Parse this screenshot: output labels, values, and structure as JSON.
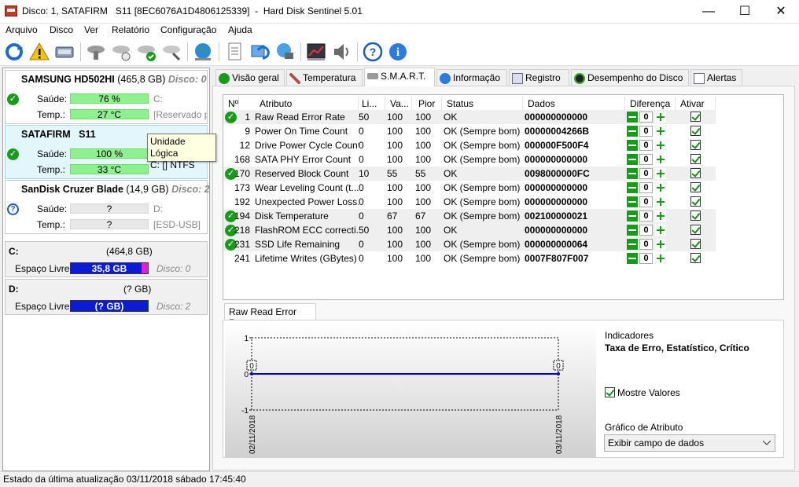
{
  "window": {
    "title": "Disco: 1, SATAFIRM   S11 [8EC6076A1D4806125339]  -  Hard Disk Sentinel 5.01",
    "minimize": "—",
    "maximize": "☐",
    "close": "✕"
  },
  "menu": [
    {
      "label": "Arquivo"
    },
    {
      "label": "Disco"
    },
    {
      "label": "Ver"
    },
    {
      "label": "Relatório"
    },
    {
      "label": "Configuração"
    },
    {
      "label": "Ajuda"
    }
  ],
  "disks": [
    {
      "name": "SAMSUNG HD502HI",
      "size": "(465,8 GB)",
      "disk": "Disco: 0",
      "health_label": "Saúde:",
      "health": "76 %",
      "temp_label": "Temp.:",
      "temp": "27 °C",
      "drive": "C:",
      "drive_note": "[Reservado p"
    },
    {
      "name": "SATAFIRM   S11",
      "size": "",
      "disk": "",
      "health_label": "Saúde:",
      "health": "100 %",
      "temp_label": "Temp.:",
      "temp": "33 °C",
      "drive": "",
      "drive_note": ""
    },
    {
      "name": "SanDisk Cruzer Blade",
      "size": "(14,9 GB)",
      "disk": "Disco: 2",
      "health_label": "Saúde:",
      "health": "?",
      "temp_label": "Temp.:",
      "temp": "?",
      "drive": "D:",
      "drive_note": "[ESD-USB]"
    }
  ],
  "tooltip": {
    "line1": "Unidade Lógica",
    "line2": "C: [] NTFS"
  },
  "volumes": [
    {
      "letter": "C:",
      "size": "(464,8 GB)",
      "free_label": "Espaço Livre",
      "free": "35,8 GB",
      "disk": "Disco: 0",
      "free_fraction": 0.077
    },
    {
      "letter": "D:",
      "size": "(? GB)",
      "free_label": "Espaço Livre",
      "free": "(? GB)",
      "disk": "Disco: 2",
      "free_fraction": 1.0
    }
  ],
  "tabs": [
    {
      "label": "Visão geral"
    },
    {
      "label": "Temperatura"
    },
    {
      "label": "S.M.A.R.T."
    },
    {
      "label": "Informação"
    },
    {
      "label": "Registro"
    },
    {
      "label": "Desempenho do Disco"
    },
    {
      "label": "Alertas"
    }
  ],
  "smart": {
    "headers": [
      "Nº",
      "Atributo",
      "Li...",
      "Va...",
      "Pior",
      "Status",
      "Dados",
      "Diferença",
      "Ativar"
    ],
    "rows": [
      {
        "icon": true,
        "num": "1",
        "attr": "Raw Read Error Rate",
        "lim": "50",
        "val": "100",
        "worst": "100",
        "status": "OK",
        "data": "000000000000",
        "diff": "0"
      },
      {
        "icon": false,
        "num": "9",
        "attr": "Power On Time Count",
        "lim": "0",
        "val": "100",
        "worst": "100",
        "status": "OK (Sempre bom)",
        "data": "00000004266B",
        "diff": "0"
      },
      {
        "icon": false,
        "num": "12",
        "attr": "Drive Power Cycle Count",
        "lim": "0",
        "val": "100",
        "worst": "100",
        "status": "OK (Sempre bom)",
        "data": "000000F500F4",
        "diff": "0"
      },
      {
        "icon": false,
        "num": "168",
        "attr": "SATA PHY Error Count",
        "lim": "0",
        "val": "100",
        "worst": "100",
        "status": "OK (Sempre bom)",
        "data": "000000000000",
        "diff": "0"
      },
      {
        "icon": true,
        "num": "170",
        "attr": "Reserved Block Count",
        "lim": "10",
        "val": "55",
        "worst": "55",
        "status": "OK",
        "data": "0098000000FC",
        "diff": "0"
      },
      {
        "icon": false,
        "num": "173",
        "attr": "Wear Leveling Count (t...",
        "lim": "0",
        "val": "100",
        "worst": "100",
        "status": "OK (Sempre bom)",
        "data": "000000000000",
        "diff": "0"
      },
      {
        "icon": false,
        "num": "192",
        "attr": "Unexpected Power Loss...",
        "lim": "0",
        "val": "100",
        "worst": "100",
        "status": "OK (Sempre bom)",
        "data": "000000000000",
        "diff": "0"
      },
      {
        "icon": true,
        "num": "194",
        "attr": "Disk Temperature",
        "lim": "0",
        "val": "67",
        "worst": "67",
        "status": "OK (Sempre bom)",
        "data": "002100000021",
        "diff": "0"
      },
      {
        "icon": true,
        "num": "218",
        "attr": "FlashROM ECC correcti...",
        "lim": "50",
        "val": "100",
        "worst": "100",
        "status": "OK",
        "data": "000000000000",
        "diff": "0"
      },
      {
        "icon": true,
        "num": "231",
        "attr": "SSD Life Remaining",
        "lim": "0",
        "val": "100",
        "worst": "100",
        "status": "OK (Sempre bom)",
        "data": "000000000064",
        "diff": "0"
      },
      {
        "icon": false,
        "num": "241",
        "attr": "Lifetime Writes (GBytes)",
        "lim": "0",
        "val": "100",
        "worst": "100",
        "status": "OK (Sempre bom)",
        "data": "0007F807F007",
        "diff": "0"
      }
    ]
  },
  "graph": {
    "tab_label": "Raw Read Error Rate",
    "indicators_label": "Indicadores",
    "indicators_value": "Taxa de Erro, Estatístico, Crítico",
    "show_values_label": "Mostre Valores",
    "attr_chart_label": "Gráfico de Atributo",
    "attr_chart_select": "Exibir campo de dados",
    "chart_data": {
      "type": "line",
      "x": [
        "02/11/2018",
        "03/11/2018"
      ],
      "y": [
        0,
        0
      ],
      "ylim": [
        -1,
        1
      ],
      "yticks": [
        "1",
        "0",
        "-1"
      ],
      "point_labels": [
        "0",
        "0"
      ],
      "line_color": "#0000c8"
    }
  },
  "status": "Estado da última atualização 03/11/2018 sábado 17:45:40"
}
